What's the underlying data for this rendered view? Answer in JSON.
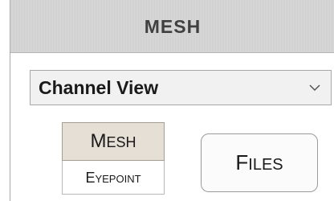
{
  "panel": {
    "title": "MESH"
  },
  "view_select": {
    "value": "Channel View",
    "icon": "chevron-down-icon"
  },
  "mode_toggle": {
    "mesh": {
      "first": "M",
      "rest": "ESH"
    },
    "eyepoint": {
      "first": "E",
      "rest": "YEPOINT"
    }
  },
  "files_button": {
    "first": "F",
    "rest": "ILES"
  },
  "colors": {
    "header_bg": "#d6d6d6",
    "toggle_selected_bg": "#e5dfd6",
    "text": "#1a1a1a"
  }
}
